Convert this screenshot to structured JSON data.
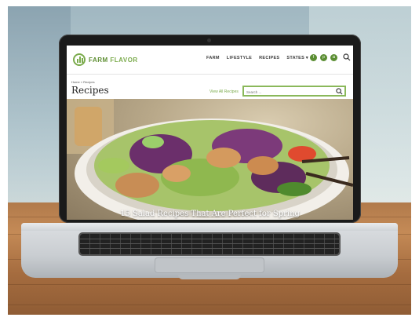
{
  "site": {
    "logo_text_1": "FARM",
    "logo_text_2": "FLAVOR",
    "nav": [
      {
        "label": "FARM"
      },
      {
        "label": "LIFESTYLE"
      },
      {
        "label": "RECIPES"
      },
      {
        "label": "STATES"
      }
    ],
    "social": [
      "facebook-icon",
      "pinterest-icon",
      "instagram-icon"
    ],
    "brand_color": "#7bab4c"
  },
  "page": {
    "breadcrumb": "Home » Recipes",
    "title": "Recipes",
    "view_all": "View All Recipes",
    "search_placeholder": "Search ...",
    "hero_caption": "15 Salad Recipes That Are Perfect for Spring"
  }
}
